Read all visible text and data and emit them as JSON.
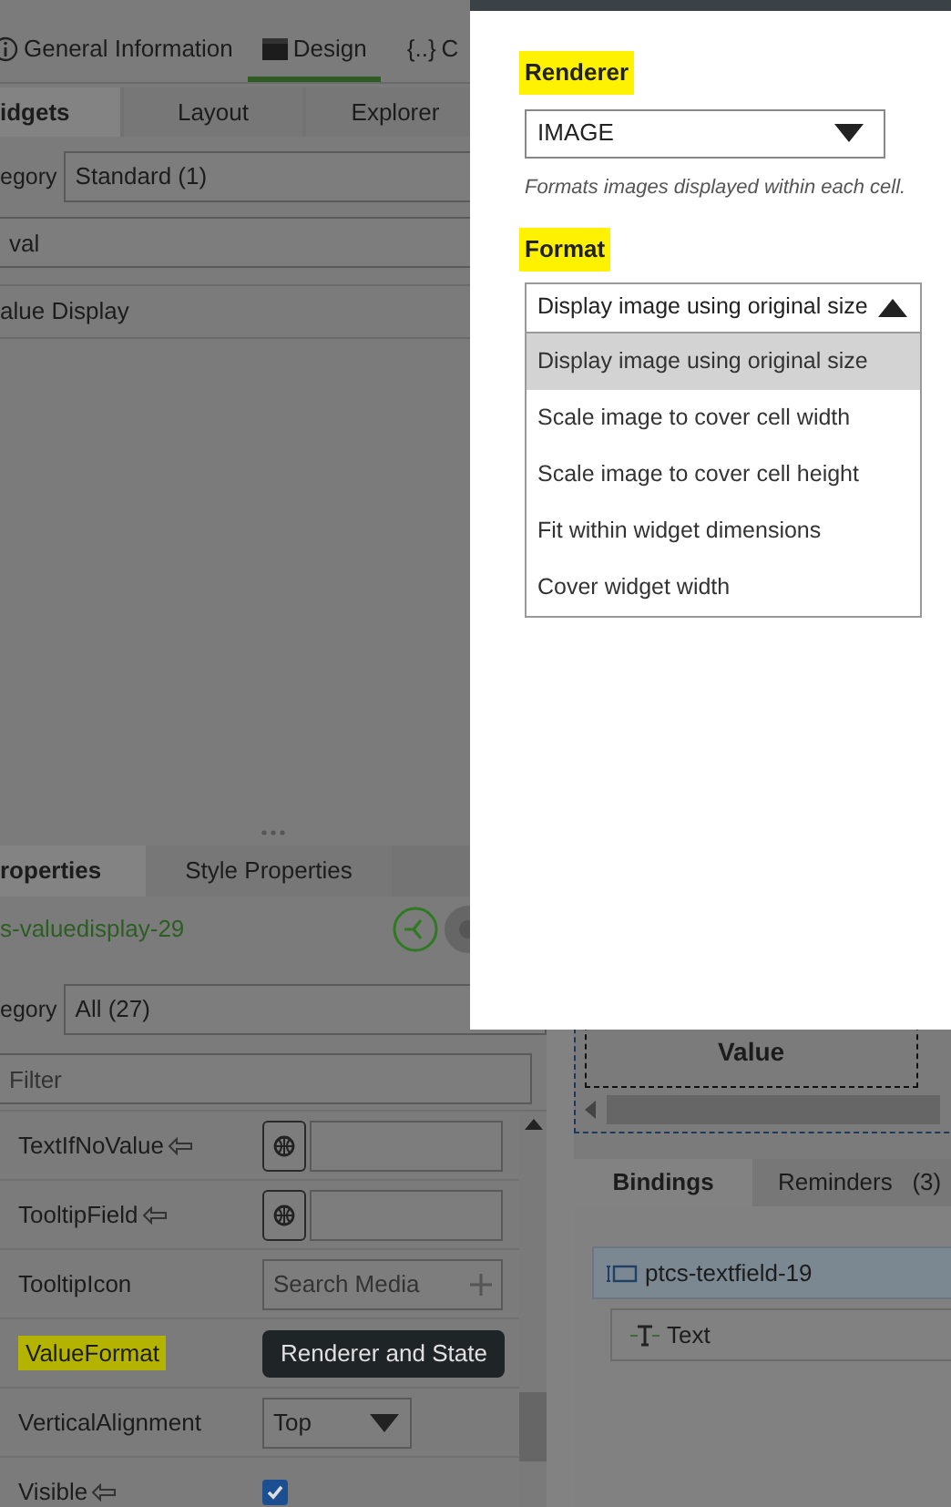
{
  "main_tabs": [
    {
      "kind": "info",
      "label": "General Information",
      "selected": false
    },
    {
      "kind": "design",
      "label": "Design",
      "selected": true
    },
    {
      "kind": "code",
      "icon_text": "{..}",
      "label": "C",
      "selected": false
    }
  ],
  "widget_tabs": [
    {
      "label": "idgets",
      "selected": true
    },
    {
      "label": "Layout",
      "selected": false
    },
    {
      "label": "Explorer",
      "selected": false
    }
  ],
  "widget_category": {
    "label": "egory",
    "value": "Standard (1)"
  },
  "widget_search": {
    "value": "val"
  },
  "widget_results": [
    "alue Display"
  ],
  "properties_tabs": [
    {
      "label": "roperties",
      "selected": true
    },
    {
      "label": "Style Properties",
      "selected": false
    }
  ],
  "widget_id": "s-valuedisplay-29",
  "property_category": {
    "label": "egory",
    "value": "All (27)"
  },
  "property_filter": {
    "placeholder": "Filter"
  },
  "properties": [
    {
      "name": "TextIfNoValue",
      "kind": "localized",
      "bindable": true,
      "highlighted": false
    },
    {
      "name": "TooltipField",
      "kind": "localized",
      "bindable": true,
      "highlighted": false
    },
    {
      "name": "TooltipIcon",
      "kind": "media",
      "placeholder": "Search Media",
      "bindable": false,
      "highlighted": false
    },
    {
      "name": "ValueFormat",
      "kind": "button",
      "button": "Renderer and State",
      "bindable": false,
      "highlighted": true
    },
    {
      "name": "VerticalAlignment",
      "kind": "select",
      "value": "Top",
      "bindable": false,
      "highlighted": false
    },
    {
      "name": "Visible",
      "kind": "checkbox",
      "checked": true,
      "bindable": true,
      "highlighted": false
    }
  ],
  "canvas_widget": {
    "label": "Value"
  },
  "bottom_tabs": [
    {
      "label": "Bindings",
      "selected": true
    },
    {
      "label": "Reminders",
      "count": "(3)",
      "selected": false
    }
  ],
  "bindings": [
    {
      "label": "ptcs-textfield-19",
      "children": [
        {
          "label": "Text"
        }
      ]
    }
  ],
  "dialog": {
    "renderer": {
      "label": "Renderer",
      "highlighted": true,
      "value": "IMAGE",
      "hint": "Formats images displayed within each cell."
    },
    "format": {
      "label": "Format",
      "highlighted": true,
      "value": "Display image using original size",
      "expanded": true,
      "options": [
        {
          "label": "Display image using original size",
          "selected": true
        },
        {
          "label": "Scale image to cover cell width",
          "selected": false
        },
        {
          "label": "Scale image to cover cell height",
          "selected": false
        },
        {
          "label": "Fit within widget dimensions",
          "selected": false
        },
        {
          "label": "Cover widget width",
          "selected": false
        }
      ]
    }
  }
}
